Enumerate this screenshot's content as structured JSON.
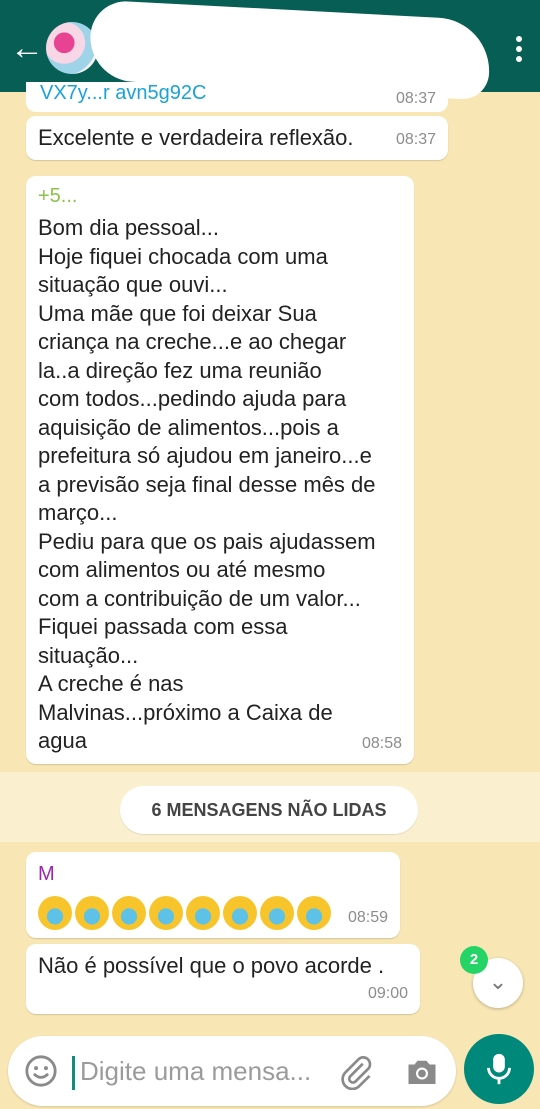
{
  "header": {
    "title": "",
    "back_icon": "arrow-left-icon",
    "menu_icon": "more-vert-icon"
  },
  "messages": {
    "link_partial": {
      "text": "VX7y...r avn5g92C",
      "time": "08:37"
    },
    "m1": {
      "text": "Excelente e verdadeira reflexão.",
      "time": "08:37"
    },
    "m2": {
      "sender": "+5...",
      "text": "Bom dia pessoal...\nHoje fiquei chocada com uma\nsituação que ouvi...\nUma mãe que foi deixar Sua\ncriança na creche...e ao chegar\nla..a direção fez uma reunião\ncom todos...pedindo ajuda para\naquisição de alimentos...pois a\nprefeitura só ajudou em janeiro...e\na previsão seja final desse mês de\nmarço...\nPediu para que os pais ajudassem\ncom alimentos ou até mesmo\ncom a contribuição de um valor...\nFiquei passada com essa\nsituação...\nA creche é nas\nMalvinas...próximo a Caixa de\nagua",
      "time": "08:58"
    },
    "unread_label": "6 MENSAGENS NÃO LIDAS",
    "m3": {
      "sender": "M",
      "time": "08:59",
      "emoji_count": 8
    },
    "m4": {
      "text": "Não é possível que o povo acorde .",
      "time": "09:00"
    }
  },
  "scroll_badge": "2",
  "input": {
    "placeholder": "Digite uma mensa..."
  },
  "colors": {
    "header": "#075e54",
    "wallpaper": "#f8e7b4",
    "accent": "#00897b",
    "badge": "#25d366"
  }
}
